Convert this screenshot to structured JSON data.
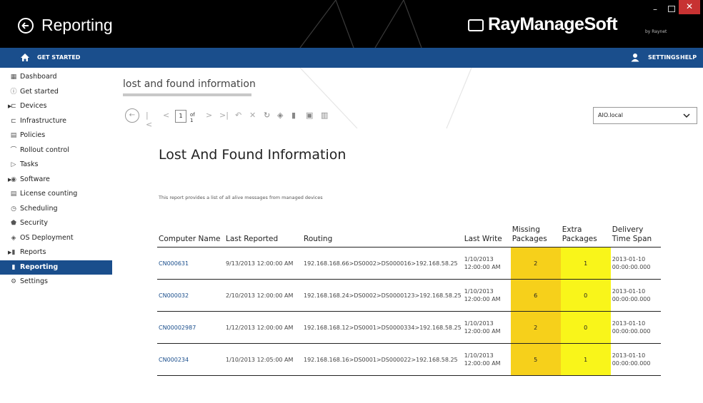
{
  "window": {
    "title": "Reporting",
    "brand": "RayManageSoft",
    "brand_sub": "by Raynet",
    "minimize": "–",
    "close": "✕"
  },
  "navbar": {
    "get_started": "GET STARTED",
    "settings": "SETTINGS",
    "help": "HELP"
  },
  "sidebar": {
    "items": [
      {
        "label": "Dashboard",
        "icon": "dashboard-icon"
      },
      {
        "label": "Get started",
        "icon": "info-icon"
      },
      {
        "label": "Devices",
        "icon": "devices-icon",
        "expandable": true
      },
      {
        "label": "Infrastructure",
        "icon": "infrastructure-icon"
      },
      {
        "label": "Policies",
        "icon": "policies-icon"
      },
      {
        "label": "Rollout control",
        "icon": "rollout-icon"
      },
      {
        "label": "Tasks",
        "icon": "tasks-icon"
      },
      {
        "label": "Software",
        "icon": "software-icon",
        "expandable": true
      },
      {
        "label": "License counting",
        "icon": "license-icon"
      },
      {
        "label": "Scheduling",
        "icon": "clock-icon"
      },
      {
        "label": "Security",
        "icon": "shield-icon"
      },
      {
        "label": "OS Deployment",
        "icon": "deployment-icon"
      },
      {
        "label": "Reports",
        "icon": "bar-chart-icon",
        "expandable": true
      },
      {
        "label": "Reporting",
        "icon": "bar-chart-icon",
        "active": true
      },
      {
        "label": "Settings",
        "icon": "gear-icon"
      }
    ]
  },
  "main": {
    "breadcrumb": "lost and found information",
    "toolbar": {
      "page": "1",
      "of": "of 1"
    },
    "select_value": "AIO.local",
    "report_title": "Lost And Found Information",
    "report_desc": "This report provides a list of all alive messages from managed devices"
  },
  "table": {
    "headers": [
      "Computer Name",
      "Last Reported",
      "Routing",
      "Last Write",
      "Missing Packages",
      "Extra Packages",
      "Delivery Time Span"
    ],
    "rows": [
      {
        "computer": "CN000631",
        "last_reported": "9/13/2013 12:00:00 AM",
        "routing": "192.168.168.66>DS0002>DS000016>192.168.58.25",
        "last_write": "1/10/2013 12:00:00 AM",
        "missing": "2",
        "extra": "1",
        "span": "2013-01-10 00:00:00.000"
      },
      {
        "computer": "CN000032",
        "last_reported": "2/10/2013 12:00:00 AM",
        "routing": "192.168.168.24>DS0002>DS0000123>192.168.58.25",
        "last_write": "1/10/2013 12:00:00 AM",
        "missing": "6",
        "extra": "0",
        "span": "2013-01-10 00:00:00.000"
      },
      {
        "computer": "CN00002987",
        "last_reported": "1/12/2013 12:00:00 AM",
        "routing": "192.168.168.12>DS0001>DS0000334>192.168.58.25",
        "last_write": "1/10/2013 12:00:00 AM",
        "missing": "2",
        "extra": "0",
        "span": "2013-01-10 00:00:00.000"
      },
      {
        "computer": "CN000234",
        "last_reported": "1/10/2013 12:05:00 AM",
        "routing": "192.168.168.16>DS0001>DS000022>192.168.58.25",
        "last_write": "1/10/2013 12:00:00 AM",
        "missing": "5",
        "extra": "1",
        "span": "2013-01-10 00:00:00.000"
      }
    ]
  },
  "colors": {
    "nav_blue": "#1a4e8c",
    "missing_fill": "#f6d01b",
    "extra_fill": "#f9f51a",
    "close_red": "#c73232"
  }
}
